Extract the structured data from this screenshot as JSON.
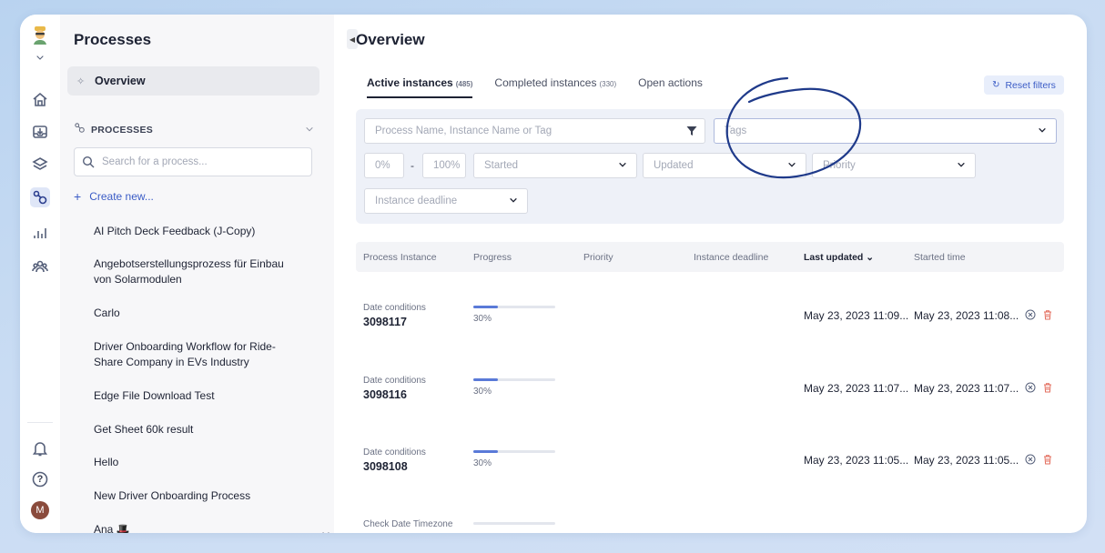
{
  "sidebar": {
    "title": "Processes",
    "overview_label": "Overview",
    "processes_header": "PROCESSES",
    "search_placeholder": "Search for a process...",
    "create_new": "Create new...",
    "items": [
      "AI Pitch Deck Feedback (J-Copy)",
      "Angebotserstellungsprozess für Einbau von Solarmodulen",
      "Carlo",
      "Driver Onboarding Workflow for Ride-Share Company in EVs Industry",
      "Edge File Download Test",
      "Get Sheet 60k result",
      "Hello",
      "New Driver Onboarding Process",
      "Ana 🎩"
    ]
  },
  "rail": {
    "avatar_initial": "M",
    "help_glyph": "?"
  },
  "main": {
    "title": "Overview",
    "tabs": [
      {
        "label": "Active instances",
        "count": "(485)"
      },
      {
        "label": "Completed instances",
        "count": "(330)"
      },
      {
        "label": "Open actions",
        "count": ""
      }
    ],
    "reset_filters": "Reset filters",
    "filters": {
      "search_placeholder": "Process Name, Instance Name or Tag",
      "tags_placeholder": "Tags",
      "progress_min": "0%",
      "progress_sep": "-",
      "progress_max": "100%",
      "started": "Started",
      "updated": "Updated",
      "priority": "Priority",
      "deadline": "Instance deadline"
    },
    "columns": [
      "Process Instance",
      "Progress",
      "Priority",
      "Instance deadline",
      "Last updated",
      "Started time"
    ],
    "sort_indicator": "⌄",
    "rows": [
      {
        "kind": "Date conditions",
        "id": "3098117",
        "progress_label": "30%",
        "progress": 0.3,
        "updated": "May 23, 2023 11:09...",
        "started": "May 23, 2023 11:08..."
      },
      {
        "kind": "Date conditions",
        "id": "3098116",
        "progress_label": "30%",
        "progress": 0.3,
        "updated": "May 23, 2023 11:07...",
        "started": "May 23, 2023 11:07..."
      },
      {
        "kind": "Date conditions",
        "id": "3098108",
        "progress_label": "30%",
        "progress": 0.3,
        "updated": "May 23, 2023 11:05...",
        "started": "May 23, 2023 11:05..."
      },
      {
        "kind": "Check Date Timezone",
        "id": "",
        "progress_label": "",
        "progress": 0.0,
        "updated": "",
        "started": ""
      }
    ]
  },
  "colors": {
    "accent": "#3b5cc6",
    "annotation": "#1f3a8a",
    "delete": "#e36c5c",
    "progress": "#5a7ad8"
  }
}
